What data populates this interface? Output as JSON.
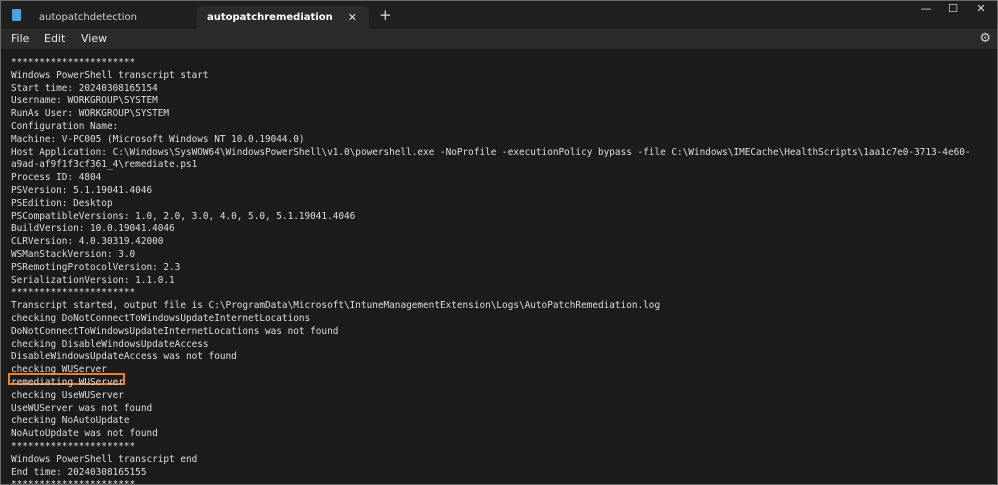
{
  "tabs": [
    {
      "label": "autopatchdetection",
      "active": false
    },
    {
      "label": "autopatchremediation",
      "active": true
    }
  ],
  "window_controls": {
    "minimize": "—",
    "maximize": "☐",
    "close": "✕"
  },
  "menu": {
    "file": "File",
    "edit": "Edit",
    "view": "View"
  },
  "editor": {
    "highlight_color": "#ef7f2a",
    "lines": [
      "**********************",
      "Windows PowerShell transcript start",
      "Start time: 20240308165154",
      "Username: WORKGROUP\\SYSTEM",
      "RunAs User: WORKGROUP\\SYSTEM",
      "Configuration Name:",
      "Machine: V-PC005 (Microsoft Windows NT 10.0.19044.0)",
      "Host Application: C:\\Windows\\SysWOW64\\WindowsPowerShell\\v1.0\\powershell.exe -NoProfile -executionPolicy bypass -file C:\\Windows\\IMECache\\HealthScripts\\1aa1c7e0-3713-4e60-",
      "a9ad-af9f1f3cf361_4\\remediate.ps1",
      "Process ID: 4804",
      "PSVersion: 5.1.19041.4046",
      "PSEdition: Desktop",
      "PSCompatibleVersions: 1.0, 2.0, 3.0, 4.0, 5.0, 5.1.19041.4046",
      "BuildVersion: 10.0.19041.4046",
      "CLRVersion: 4.0.30319.42000",
      "WSManStackVersion: 3.0",
      "PSRemotingProtocolVersion: 2.3",
      "SerializationVersion: 1.1.0.1",
      "**********************",
      "Transcript started, output file is C:\\ProgramData\\Microsoft\\IntuneManagementExtension\\Logs\\AutoPatchRemediation.log",
      "checking DoNotConnectToWindowsUpdateInternetLocations",
      "DoNotConnectToWindowsUpdateInternetLocations was not found",
      "checking DisableWindowsUpdateAccess",
      "DisableWindowsUpdateAccess was not found",
      "checking WUServer",
      "remediating WUServer",
      "checking UseWUServer",
      "UseWUServer was not found",
      "checking NoAutoUpdate",
      "NoAutoUpdate was not found",
      "**********************",
      "Windows PowerShell transcript end",
      "End time: 20240308165155",
      "**********************"
    ]
  }
}
